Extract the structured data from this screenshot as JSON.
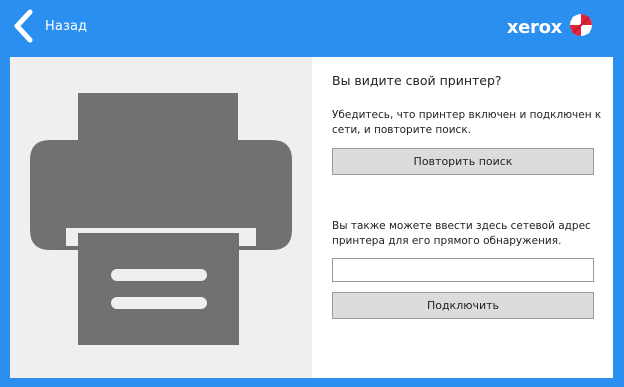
{
  "header": {
    "back_label": "Назад",
    "brand": "xerox",
    "icons": {
      "back": "chevron-left-icon",
      "brand": "xerox-sphere-logo"
    }
  },
  "illustration": {
    "icon": "printer-icon"
  },
  "main": {
    "heading": "Вы видите свой принтер?",
    "retry_text": "Убедитесь, что принтер включен и подключен к сети, и повторите поиск.",
    "retry_button": "Повторить поиск",
    "address_text": "Вы также можете ввести здесь сетевой адрес принтера для его прямого обнаружения.",
    "address_value": "",
    "connect_button": "Подключить"
  },
  "colors": {
    "accent": "#2b8ff0",
    "printer": "#717171",
    "illustration_bg": "#efefef",
    "logo_red": "#e3233a"
  }
}
